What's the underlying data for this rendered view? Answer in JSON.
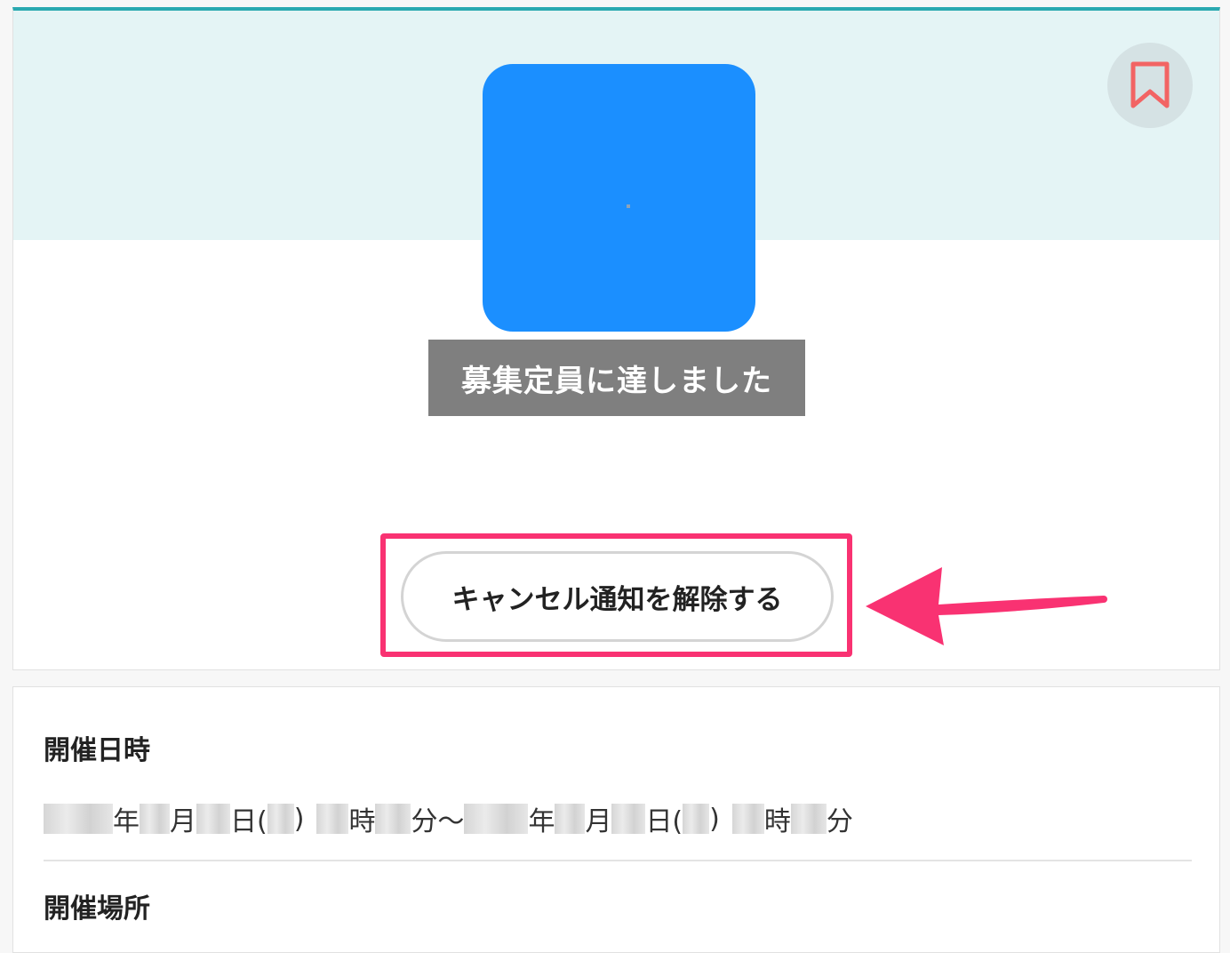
{
  "event_status": {
    "badge_text": "募集定員に達しました",
    "cancel_notification_button": "キャンセル通知を解除する"
  },
  "details": {
    "date_heading": "開催日時",
    "date_parts": {
      "year1": "年",
      "month1": "月",
      "day1": "日(",
      "close1": ")",
      "hour1": "時",
      "min1": "分〜",
      "year2": "年",
      "month2": "月",
      "day2": "日(",
      "close2": ")",
      "hour2": "時",
      "min2": "分"
    },
    "place_heading": "開催場所"
  },
  "colors": {
    "accent_teal": "#2aa9b0",
    "image_blue": "#1b8fff",
    "highlight_pink": "#f93272",
    "bookmark_red": "#f26464"
  },
  "icons": {
    "bookmark": "bookmark-icon",
    "annotation_arrow": "arrow-left-icon"
  }
}
